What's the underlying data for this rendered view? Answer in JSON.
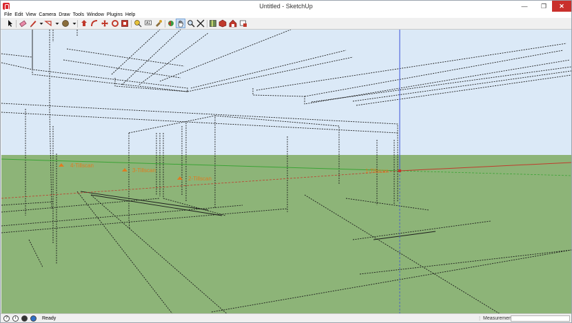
{
  "window": {
    "title": "Untitled - SketchUp",
    "minimize_glyph": "—",
    "maximize_glyph": "❐",
    "close_glyph": "✕"
  },
  "menu": [
    "File",
    "Edit",
    "View",
    "Camera",
    "Draw",
    "Tools",
    "Window",
    "Plugins",
    "Help"
  ],
  "toolbar": {
    "tools": [
      "select-icon",
      "eraser-icon",
      "pencil-icon",
      "dropdown-arrow-icon",
      "shape-icon",
      "dropdown-arrow-icon",
      "paint-bucket-icon",
      "dropdown-arrow-icon",
      "push-pull-icon",
      "follow-me-icon",
      "move-icon",
      "rotate-icon",
      "scale-icon",
      "tape-measure-icon",
      "text-icon",
      "paint-icon",
      "orbit-icon",
      "pan-icon",
      "zoom-icon",
      "zoom-extents-icon",
      "section-plane-icon",
      "components-icon",
      "warehouse-icon",
      "extension-icon"
    ],
    "active_tool": "pan-icon"
  },
  "viewport": {
    "sky_color": "#dbe9f7",
    "ground_color": "#8db478",
    "axis_colors": {
      "red": "#c0392b",
      "green": "#3aa335",
      "blue": "#3a4fd8"
    },
    "section_labels": [
      {
        "text": "4-Tillscan",
        "name": "section-label-4"
      },
      {
        "text": "3-Tillscan",
        "name": "section-label-3"
      },
      {
        "text": "2-Tillscan",
        "name": "section-label-2"
      },
      {
        "text": "1-Tillscan",
        "name": "section-label-1"
      }
    ]
  },
  "status": {
    "text": "Ready",
    "measurements_label": "Measurements",
    "measurements_value": ""
  }
}
